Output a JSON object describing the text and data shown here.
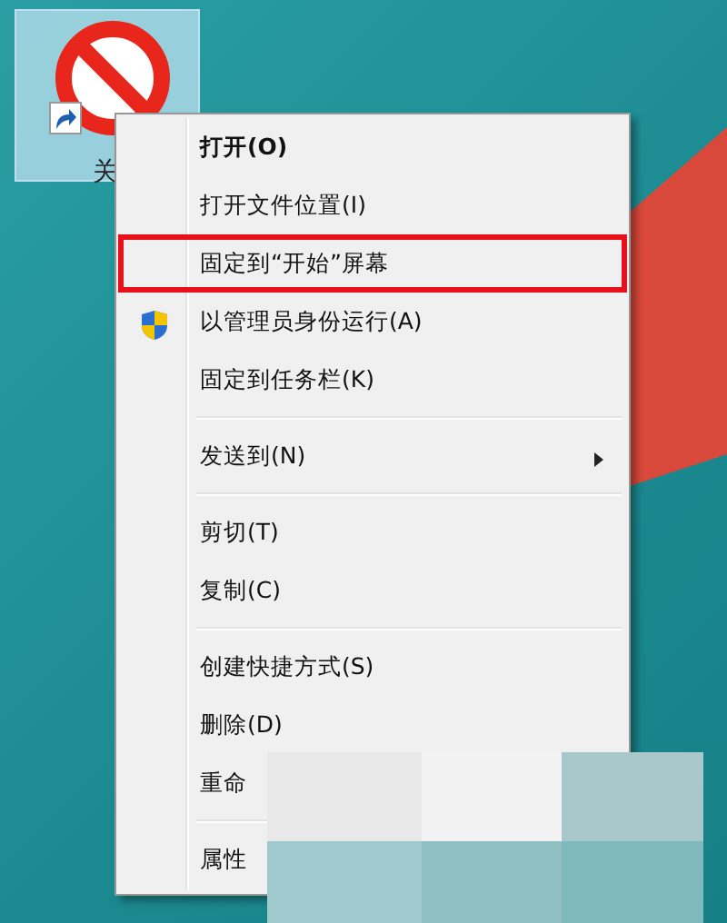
{
  "desktop_icon": {
    "label": "关",
    "selected": true
  },
  "context_menu": {
    "items": [
      {
        "kind": "default",
        "label": "打开(O)",
        "highlighted": false
      },
      {
        "kind": "item",
        "label": "打开文件位置(I)",
        "highlighted": false
      },
      {
        "kind": "item",
        "label": "固定到“开始”屏幕",
        "highlighted": true
      },
      {
        "kind": "shield",
        "label": "以管理员身份运行(A)",
        "highlighted": false
      },
      {
        "kind": "item",
        "label": "固定到任务栏(K)",
        "highlighted": false
      },
      {
        "kind": "separator"
      },
      {
        "kind": "submenu",
        "label": "发送到(N)",
        "highlighted": false
      },
      {
        "kind": "separator"
      },
      {
        "kind": "item",
        "label": "剪切(T)",
        "highlighted": false
      },
      {
        "kind": "item",
        "label": "复制(C)",
        "highlighted": false
      },
      {
        "kind": "separator"
      },
      {
        "kind": "item",
        "label": "创建快捷方式(S)",
        "highlighted": false
      },
      {
        "kind": "item",
        "label": "删除(D)",
        "highlighted": false
      },
      {
        "kind": "item",
        "label": "重命",
        "highlighted": false
      },
      {
        "kind": "separator"
      },
      {
        "kind": "item",
        "label": "属性",
        "highlighted": false
      }
    ]
  }
}
